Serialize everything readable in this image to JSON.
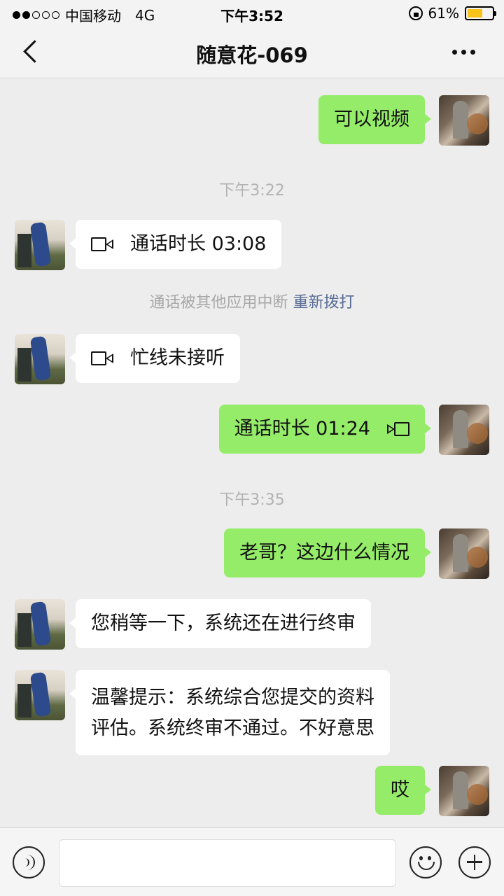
{
  "status_bar": {
    "carrier": "中国移动",
    "network": "4G",
    "time": "下午3:52",
    "battery": "61%",
    "battery_level": 0.61
  },
  "nav": {
    "title": "随意花-069"
  },
  "messages": [
    {
      "type": "text",
      "from": "me",
      "text": "可以视频"
    },
    {
      "type": "time",
      "text": "下午3:22"
    },
    {
      "type": "call",
      "from": "other",
      "text": "通话时长 03:08"
    },
    {
      "type": "system",
      "text": "通话被其他应用中断",
      "action": "重新拨打"
    },
    {
      "type": "call",
      "from": "other",
      "text": "忙线未接听"
    },
    {
      "type": "call",
      "from": "me",
      "text": "通话时长 01:24"
    },
    {
      "type": "time",
      "text": "下午3:35"
    },
    {
      "type": "text",
      "from": "me",
      "text": "老哥？这边什么情况"
    },
    {
      "type": "text",
      "from": "other",
      "text": "您稍等一下，系统还在进行终审"
    },
    {
      "type": "text",
      "from": "other",
      "lines": [
        "温馨提示：系统综合您提交的资料",
        "评估。系统终审不通过。不好意思"
      ]
    },
    {
      "type": "text",
      "from": "me",
      "text": "哎"
    }
  ],
  "input_bar": {
    "placeholder": "",
    "icons": [
      "voice-icon",
      "emoji-icon",
      "plus-icon"
    ]
  },
  "colors": {
    "background": "#ededed",
    "my_bubble": "#95ec69",
    "other_bubble": "#ffffff",
    "link": "#576b95"
  }
}
